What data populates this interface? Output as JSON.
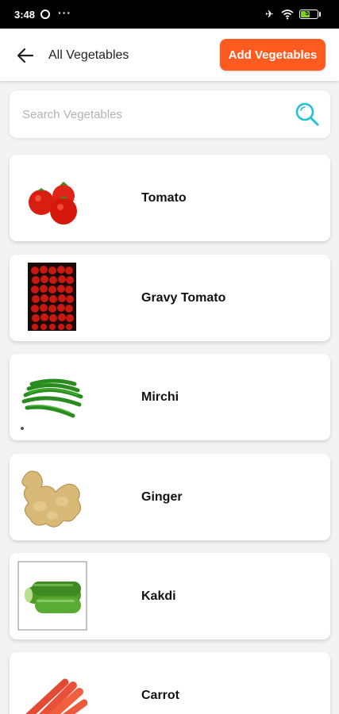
{
  "status_bar": {
    "time": "3:48",
    "dots": "···",
    "battery": "51"
  },
  "header": {
    "title": "All Vegetables",
    "add_button": "Add Vegetables"
  },
  "search": {
    "placeholder": "Search Vegetables"
  },
  "vegetables": [
    {
      "name": "Tomato",
      "icon": "tomato-image"
    },
    {
      "name": "Gravy Tomato",
      "icon": "gravy-tomato-image"
    },
    {
      "name": "Mirchi",
      "icon": "mirchi-image"
    },
    {
      "name": "Ginger",
      "icon": "ginger-image"
    },
    {
      "name": "Kakdi",
      "icon": "kakdi-image"
    },
    {
      "name": "Carrot",
      "icon": "carrot-image"
    }
  ],
  "colors": {
    "accent": "#ff5a1f",
    "search_icon": "#22c1d8"
  }
}
